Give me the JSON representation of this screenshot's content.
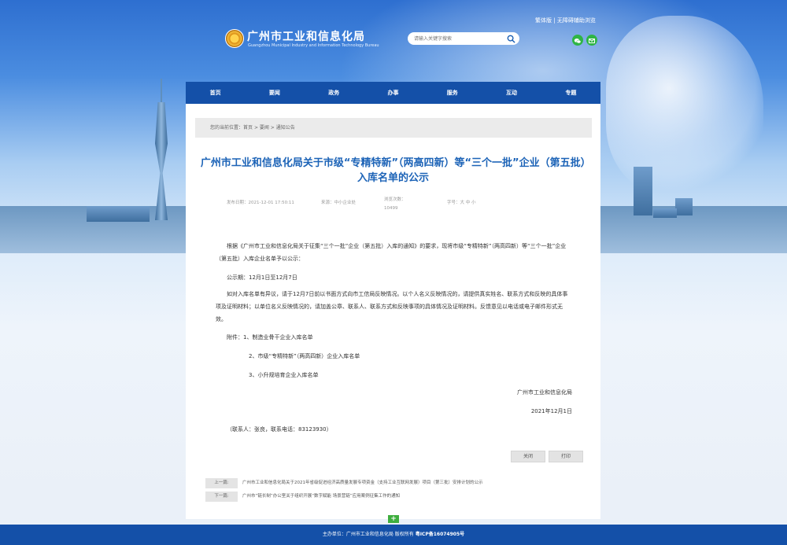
{
  "header": {
    "site_title": "广州市工业和信息化局",
    "site_subtitle": "Guangzhou Municipal Industry and Information Technology Bureau",
    "search_placeholder": "请输入关键字搜索",
    "top_links": [
      "繁体版",
      "无障碍辅助浏览"
    ]
  },
  "nav": {
    "items": [
      "首页",
      "要闻",
      "政务",
      "办事",
      "服务",
      "互动",
      "专题"
    ]
  },
  "breadcrumb": {
    "label": "您的当前位置：",
    "items": [
      "首页",
      "要闻",
      "通知公告"
    ],
    "separator": " > "
  },
  "article": {
    "title": "广州市工业和信息化局关于市级“专精特新”（两高四新）等“三个一批”企业（第五批）入库名单的公示",
    "meta": {
      "publish_date": "发布日期：2021-12-01 17:50:11",
      "source": "来源：中小企业处",
      "views_label": "浏览次数：",
      "views_count": "10499",
      "font_size": "字号：大  中  小"
    },
    "paragraphs": [
      "根据《广州市工业和信息化局关于征集“三个一批”企业（第五批）入库的通知》的要求，现将市级“专精特新”（两高四新）等“三个一批”企业（第五批）入库企业名单予以公示：",
      "公示期：12月1日至12月7日",
      "如对入库名单有异议，请于12月7日前以书面方式向市工信局反映情况。以个人名义反映情况的，请提供真实姓名、联系方式和反映的具体事项及证明材料；以单位名义反映情况的，请加盖公章、联系人、联系方式和反映事项的具体情况及证明材料。反馈意见以电话或电子邮件形式无效。",
      "附件：1、制造业骨干企业入库名单",
      "2、市级“专精特新”（两高四新）企业入库名单",
      "3、小升规培育企业入库名单"
    ],
    "signature_org": "广州市工业和信息化局",
    "signature_date": "2021年12月1日",
    "contact": "（联系人：张良，联系电话：83123930）",
    "close_label": "关闭",
    "print_label": "打印"
  },
  "prevnext": {
    "prev_label": "上一篇:",
    "prev_title": "广州市工业和信息化局关于2021年省级促进经济高质量发展专项资金（支持工业互联网发展）项目（第三批）安排计划的公示",
    "next_label": "下一篇:",
    "next_title": "广州市“链长制”办公室关于组织开展“数字赋能 场景营链”应用案例征集工作的通知"
  },
  "footer": {
    "text": "主办单位：广州市工业和信息化局 版权所有",
    "icp": "粤ICP备16074905号"
  },
  "colors": {
    "nav_bg": "#1450a8",
    "title": "#1c63b7",
    "footer_bg": "#1450a8",
    "expand_button": "#3fae3f"
  },
  "icons": {
    "search": "search-icon",
    "wechat": "wechat-icon",
    "mail": "mail-icon",
    "expand": "plus-icon"
  }
}
